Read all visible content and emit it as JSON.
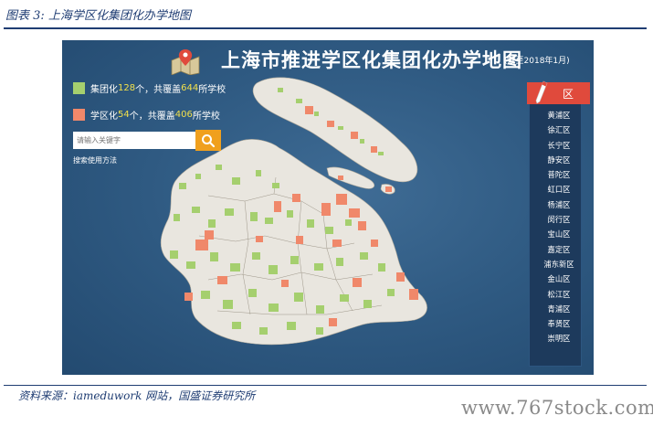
{
  "figure": {
    "caption": "图表 3: 上海学区化集团化办学地图"
  },
  "map": {
    "title": "上海市推进学区化集团化办学地图",
    "date_note": "(截至2018年1月)",
    "legend": [
      {
        "pre": "集团化",
        "count": "128",
        "mid": "个，共覆盖",
        "schools": "644",
        "post": "所学校",
        "color": "#a5cf6e"
      },
      {
        "pre": "学区化",
        "count": "54",
        "mid": "个，共覆盖",
        "schools": "406",
        "post": "所学校",
        "color": "#f0886a"
      }
    ],
    "search": {
      "placeholder": "请输入关键字",
      "icon": "search-icon",
      "help_link": "搜索使用方法"
    },
    "district_panel": {
      "header": "区",
      "districts": [
        "黄浦区",
        "徐汇区",
        "长宁区",
        "静安区",
        "普陀区",
        "虹口区",
        "杨浦区",
        "闵行区",
        "宝山区",
        "嘉定区",
        "浦东新区",
        "金山区",
        "松江区",
        "青浦区",
        "奉贤区",
        "崇明区"
      ]
    },
    "colors": {
      "land": "#e9e6df",
      "group": "#a5cf6e",
      "district": "#f0886a",
      "panel_bg": "#2f5a82",
      "header": "#e04a3c"
    }
  },
  "source": {
    "text": "资料来源：iameduwork 网站，国盛证券研究所"
  },
  "watermark": {
    "text": "www.767stock.com"
  }
}
